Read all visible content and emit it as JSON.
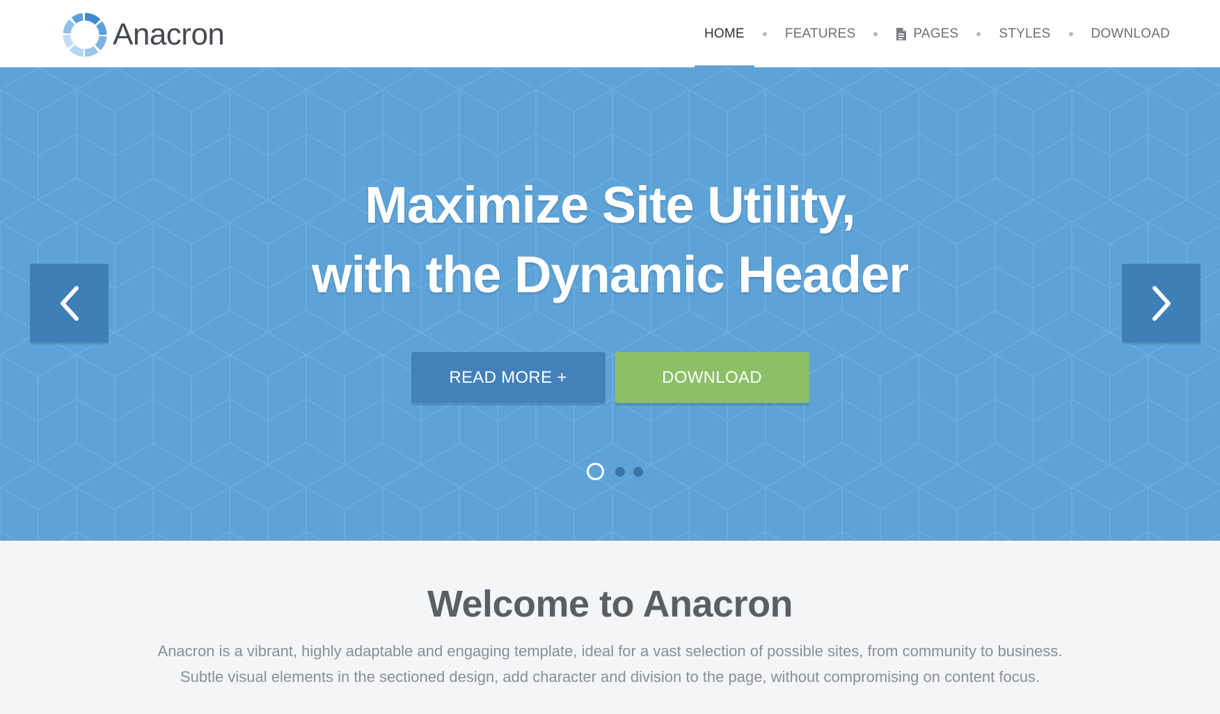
{
  "brand": {
    "name": "Anacron"
  },
  "nav": {
    "items": [
      {
        "label": "HOME",
        "active": true
      },
      {
        "label": "FEATURES",
        "active": false
      },
      {
        "label": "PAGES",
        "active": false,
        "icon": "document-icon"
      },
      {
        "label": "STYLES",
        "active": false
      },
      {
        "label": "DOWNLOAD",
        "active": false
      }
    ]
  },
  "hero": {
    "title_line1": "Maximize Site Utility,",
    "title_line2": "with the Dynamic Header",
    "read_more_label": "READ MORE +",
    "download_label": "DOWNLOAD",
    "prev_icon": "chevron-left-icon",
    "next_icon": "chevron-right-icon",
    "slides_total": 3,
    "active_slide": 1
  },
  "welcome": {
    "title": "Welcome to Anacron",
    "line1": "Anacron is a vibrant, highly adaptable and engaging template, ideal for a vast selection of possible sites, from community to business.",
    "line2": "Subtle visual elements in the sectioned design, add character and division to the page, without compromising on content focus."
  },
  "colors": {
    "hero_bg": "#5ea3d8",
    "primary_button": "#4281ba",
    "download_button": "#8cbf66",
    "nav_active_underline": "#5fa4d8",
    "arrow_bg": "#3f7fb8"
  }
}
